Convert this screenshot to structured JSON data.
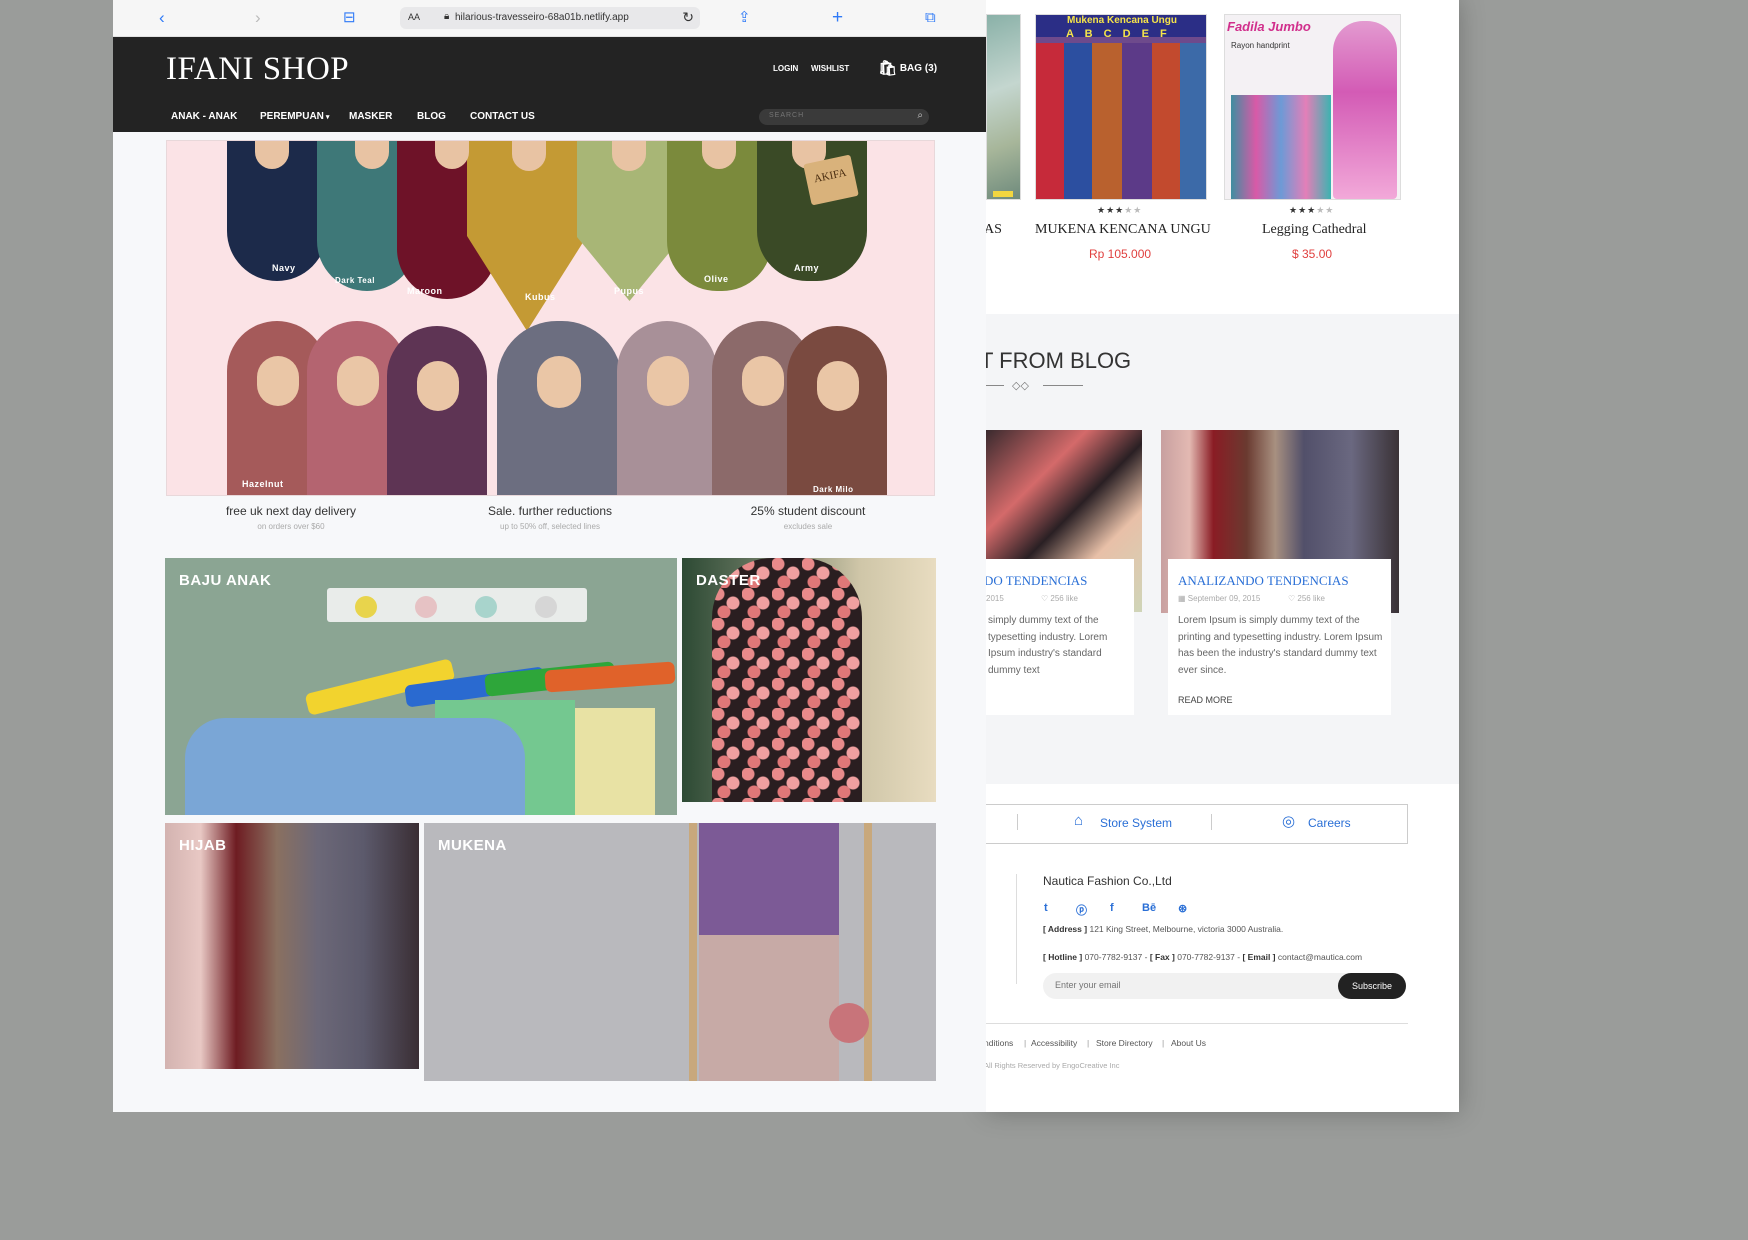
{
  "browser": {
    "text_size_label": "AA",
    "url": "hilarious-travesseiro-68a01b.netlify.app"
  },
  "header": {
    "logo": "IFANI SHOP",
    "login": "LOGIN",
    "wishlist": "WISHLIST",
    "bag": "BAG (3)",
    "menu": [
      "ANAK - ANAK",
      "PEREMPUAN",
      "MASKER",
      "BLOG",
      "CONTACT US"
    ],
    "search_placeholder": "SEARCH"
  },
  "hero": {
    "brand_tag": "AKIFA",
    "color_labels": [
      "Navy",
      "Dark Teal",
      "Maroon",
      "Kubus",
      "Pupus",
      "Olive",
      "Army",
      "Hazelnut",
      "Dark Milo"
    ]
  },
  "promos": [
    {
      "title": "free uk next day delivery",
      "subtitle": "on orders over $60"
    },
    {
      "title": "Sale. further reductions",
      "subtitle": "up to 50% off, selected lines"
    },
    {
      "title": "25% student discount",
      "subtitle": "excludes sale"
    }
  ],
  "categories": [
    "BAJU ANAK",
    "DASTER",
    "HIJAB",
    "MUKENA"
  ],
  "background_page": {
    "products": [
      {
        "name": "AS",
        "rating": null,
        "price": null
      },
      {
        "name": "MUKENA KENCANA UNGU",
        "rating": 3,
        "price": "Rp 105.000",
        "image_caption": "A B C D E F",
        "image_heading": "Mukena Kencana Ungu"
      },
      {
        "name": "Legging Cathedral",
        "rating": 3,
        "price": "$ 35.00",
        "image_heading": "Fadila Jumbo",
        "image_caption": "Rayon handprint"
      }
    ],
    "blog_title": "T FROM BLOG",
    "blog_posts": [
      {
        "title": "DO TENDENCIAS",
        "date": "2015",
        "likes": "256 like",
        "excerpt": "simply dummy text of the typesetting industry. Lorem Ipsum industry's standard dummy text"
      },
      {
        "title": "ANALIZANDO TENDENCIAS",
        "date": "September 09, 2015",
        "likes": "256 like",
        "excerpt": "Lorem Ipsum is simply dummy text of the printing and typesetting industry. Lorem Ipsum has been the industry's standard dummy text ever since.",
        "read_more": "READ MORE"
      }
    ],
    "footer_links": [
      "Store System",
      "Careers"
    ],
    "company": "Nautica Fashion Co.,Ltd",
    "social_icons": [
      "twitter-icon",
      "pinterest-icon",
      "facebook-icon",
      "behance-icon",
      "dribbble-icon"
    ],
    "address_label": "[ Address ]",
    "address": "121 King Street, Melbourne, victoria 3000 Australia.",
    "hotline_label": "[ Hotline ]",
    "hotline": "070-7782-9137",
    "fax_label": "[ Fax ]",
    "fax": "070-7782-9137",
    "email_label": "[ Email ]",
    "email": "contact@mautica.com",
    "email_placeholder": "Enter your email",
    "subscribe": "Subscribe",
    "bottom_links": [
      "nditions",
      "Accessibility",
      "Store Directory",
      "About Us"
    ],
    "copyright": "All Rights Reserved by EngoCreative Inc"
  },
  "colors": {
    "accent": "#2a6fd6",
    "price": "#e0403f",
    "nav": "#232323"
  }
}
